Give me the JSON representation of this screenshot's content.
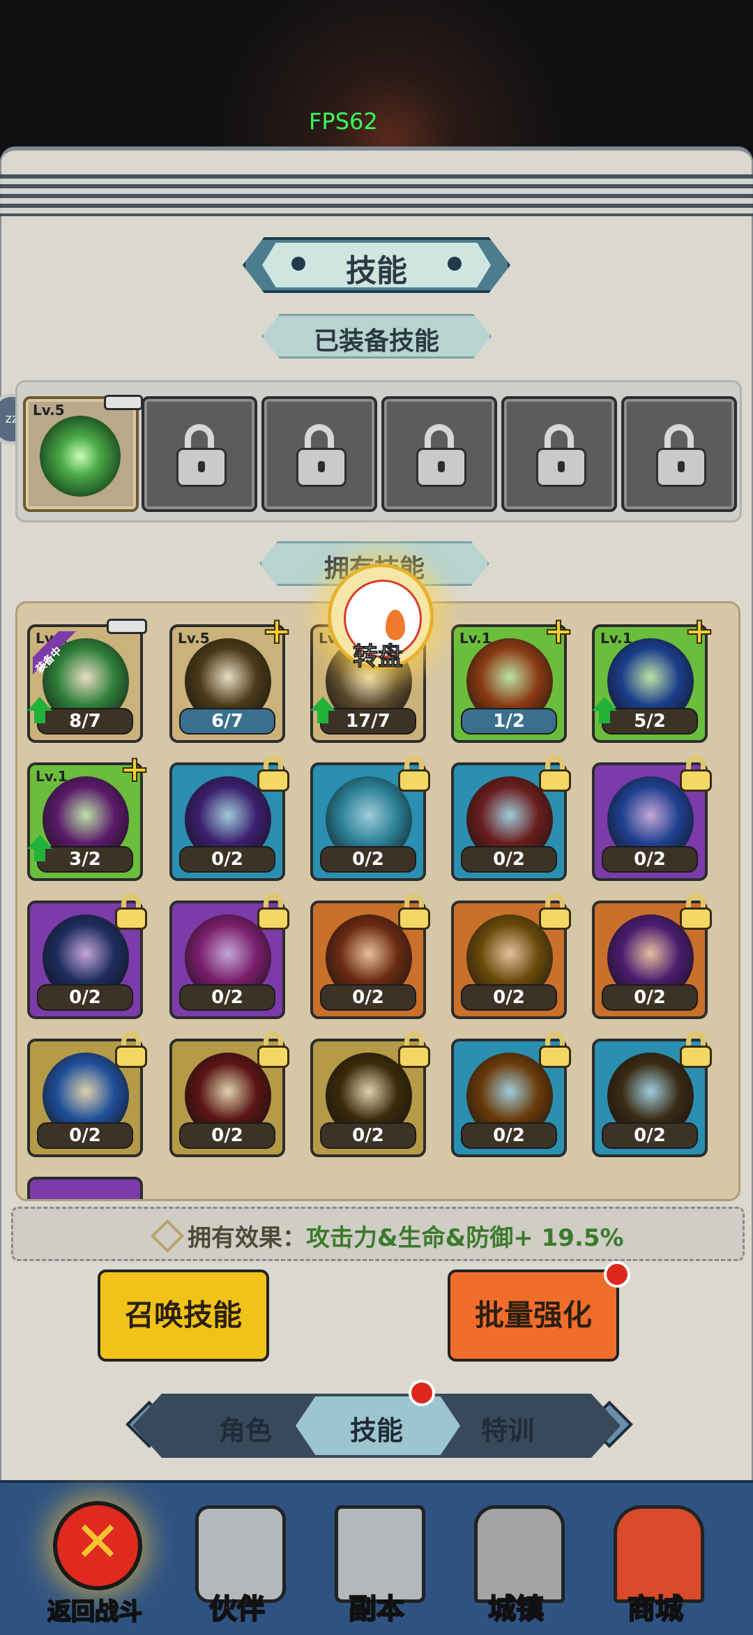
{
  "fps": "FPS62",
  "side_button": "zz",
  "title": "技能",
  "equipped_title": "已装备技能",
  "equipped_slot": {
    "level": "Lv.5"
  },
  "locked_slots": 5,
  "owned_title": "拥有技能",
  "wheel_label": "转盘",
  "equip_tag": "装备中",
  "cards": [
    {
      "level": "Lv.1",
      "count": "8/7",
      "orb": "#2e7f3a",
      "border": "#cbb27b",
      "badge": "minus",
      "up": true,
      "tag": true
    },
    {
      "level": "Lv.5",
      "count": "6/7",
      "orb": "#4a3a18",
      "border": "#cbb27b",
      "badge": "plus",
      "up": false
    },
    {
      "level": "Lv.1",
      "count": "17/7",
      "orb": "#5a4a2e",
      "border": "#cbb27b",
      "badge": "plus",
      "up": true
    },
    {
      "level": "Lv.1",
      "count": "1/2",
      "orb": "#8a3a12",
      "border": "#6bbe3c",
      "badge": "plus",
      "up": false
    },
    {
      "level": "Lv.1",
      "count": "5/2",
      "orb": "#1b3d8a",
      "border": "#6bbe3c",
      "badge": "plus",
      "up": true
    },
    {
      "level": "Lv.1",
      "count": "3/2",
      "orb": "#5a1a6a",
      "border": "#6bbe3c",
      "badge": "plus",
      "up": true
    },
    {
      "level": "",
      "count": "0/2",
      "orb": "#3b1f6e",
      "border": "#2a8fb0",
      "badge": "lock"
    },
    {
      "level": "",
      "count": "0/2",
      "orb": "#2a7f95",
      "border": "#2a8fb0",
      "badge": "lock"
    },
    {
      "level": "",
      "count": "0/2",
      "orb": "#6a1d1d",
      "border": "#2a8fb0",
      "badge": "lock"
    },
    {
      "level": "",
      "count": "0/2",
      "orb": "#1f3f8f",
      "border": "#7b3ba8",
      "badge": "lock"
    },
    {
      "level": "",
      "count": "0/2",
      "orb": "#1e2c5e",
      "border": "#7b3ba8",
      "badge": "lock"
    },
    {
      "level": "",
      "count": "0/2",
      "orb": "#7a1e6b",
      "border": "#7b3ba8",
      "badge": "lock"
    },
    {
      "level": "",
      "count": "0/2",
      "orb": "#6a2a12",
      "border": "#c9702a",
      "badge": "lock"
    },
    {
      "level": "",
      "count": "0/2",
      "orb": "#6a4a0a",
      "border": "#c9702a",
      "badge": "lock"
    },
    {
      "level": "",
      "count": "0/2",
      "orb": "#4a1c6e",
      "border": "#c9702a",
      "badge": "lock"
    },
    {
      "level": "",
      "count": "0/2",
      "orb": "#1f4f9a",
      "border": "#b59a48",
      "badge": "lock"
    },
    {
      "level": "",
      "count": "0/2",
      "orb": "#5a1414",
      "border": "#b59a48",
      "badge": "lock"
    },
    {
      "level": "",
      "count": "0/2",
      "orb": "#3a2a0a",
      "border": "#b59a48",
      "badge": "lock"
    },
    {
      "level": "",
      "count": "0/2",
      "orb": "#6a3a0a",
      "border": "#2a8fb0",
      "badge": "lock"
    },
    {
      "level": "",
      "count": "0/2",
      "orb": "#3a2a14",
      "border": "#2a8fb0",
      "badge": "lock"
    }
  ],
  "effect": {
    "label": "拥有效果：",
    "value": "攻击力&生命&防御+ 19.5%"
  },
  "buttons": {
    "summon": "召唤技能",
    "upgrade": "批量强化"
  },
  "tabs": {
    "role": "角色",
    "skill": "技能",
    "training": "特训"
  },
  "nav": {
    "back": "返回战斗",
    "partner": "伙伴",
    "dungeon": "副本",
    "town": "城镇",
    "shop": "商城"
  }
}
